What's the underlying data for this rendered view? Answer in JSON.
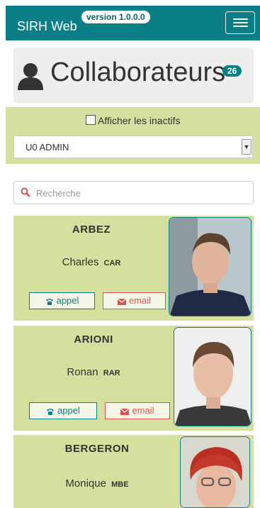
{
  "navbar": {
    "brand": "SIRH Web",
    "version": "version 1.0.0.0",
    "menu_icon": "hamburger-icon"
  },
  "page": {
    "title": "Collaborateurs",
    "count": "26",
    "title_icon": "user-icon"
  },
  "filters": {
    "show_inactive_label": "Afficher les inactifs",
    "show_inactive_checked": false,
    "org_unit_selected": "U0 ADMIN"
  },
  "search": {
    "placeholder": "Recherche",
    "icon": "search-icon"
  },
  "collaborators": [
    {
      "last_name": "ARBEZ",
      "first_name": "Charles",
      "initials": "CAR",
      "call_label": "appel",
      "email_label": "email"
    },
    {
      "last_name": "ARIONI",
      "first_name": "Ronan",
      "initials": "RAR",
      "call_label": "appel",
      "email_label": "email"
    },
    {
      "last_name": "BERGERON",
      "first_name": "Monique",
      "initials": "MBE"
    }
  ],
  "colors": {
    "primary": "#0b7f86",
    "card_bg": "#d6e09e",
    "danger": "#d9534f"
  }
}
